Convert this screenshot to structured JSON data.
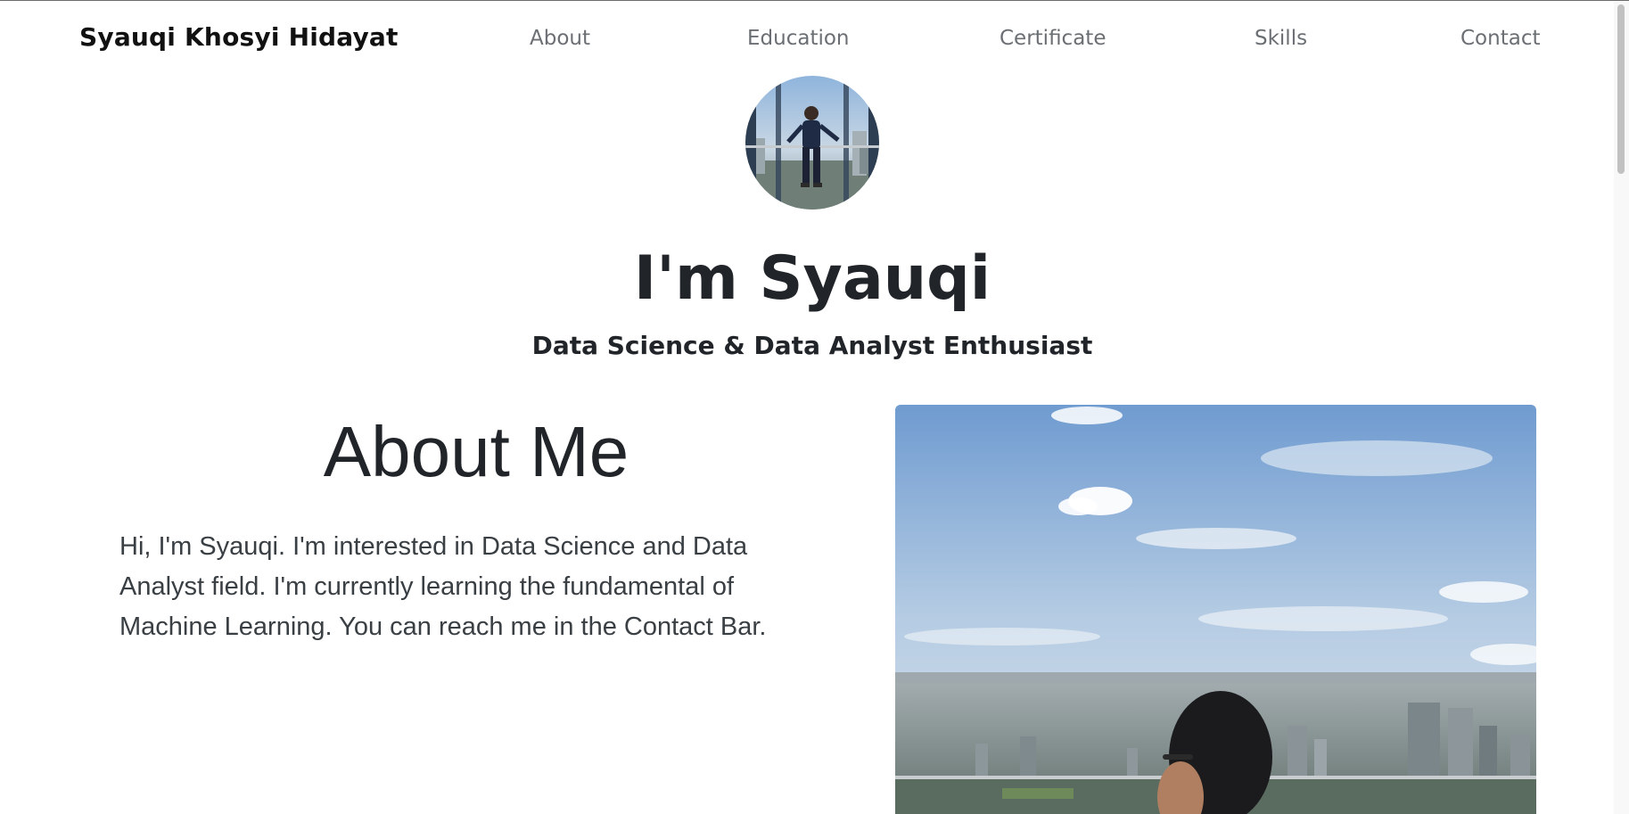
{
  "navbar": {
    "brand": "Syauqi Khosyi Hidayat",
    "items": [
      {
        "label": "About"
      },
      {
        "label": "Education"
      },
      {
        "label": "Certificate"
      },
      {
        "label": "Skills"
      },
      {
        "label": "Contact"
      }
    ]
  },
  "hero": {
    "title": "I'm Syauqi",
    "subtitle": "Data Science & Data Analyst Enthusiast"
  },
  "about": {
    "heading": "About Me",
    "body": "Hi, I'm Syauqi. I'm interested in Data Science and Data Analyst field. I'm currently learning the fundamental of Machine Learning. You can reach me in the Contact Bar."
  },
  "colors": {
    "text": "#212529",
    "nav_link": "#6b6f73",
    "background": "#ffffff"
  }
}
